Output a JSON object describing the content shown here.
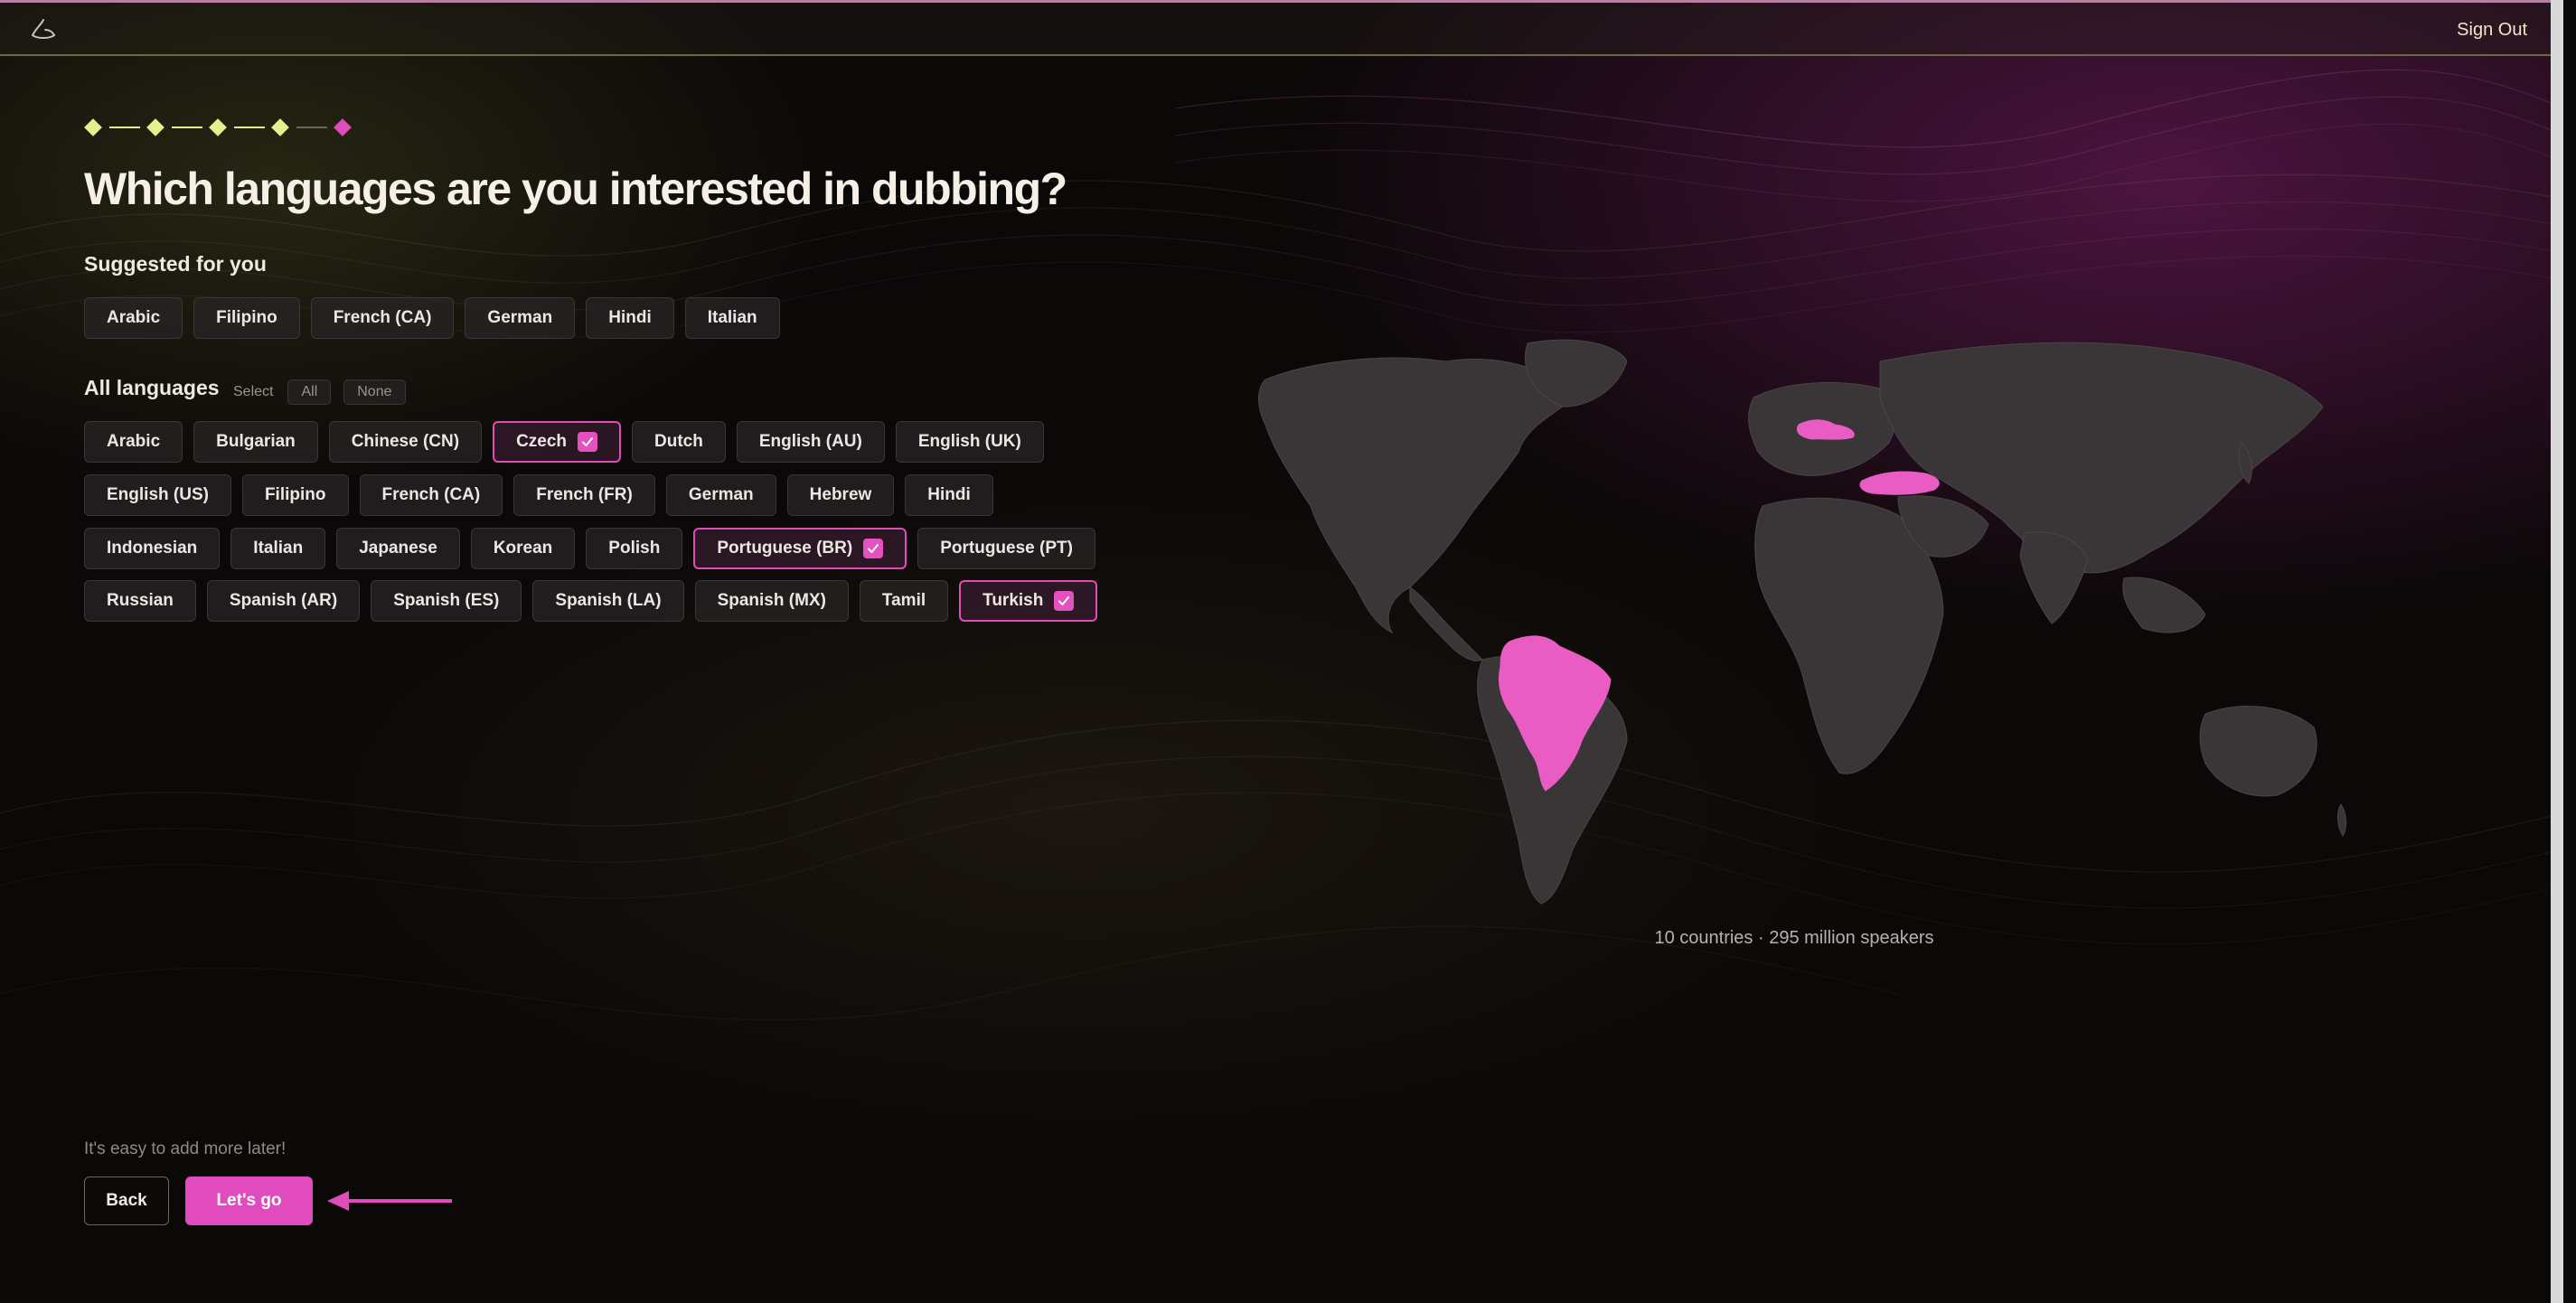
{
  "topbar": {
    "sign_out_label": "Sign Out"
  },
  "progress": {
    "total_steps": 5,
    "current_step": 5
  },
  "page": {
    "title": "Which languages are you interested in dubbing?"
  },
  "suggested": {
    "label": "Suggested for you",
    "items": [
      "Arabic",
      "Filipino",
      "French (CA)",
      "German",
      "Hindi",
      "Italian"
    ]
  },
  "all_languages": {
    "label": "All languages",
    "select_label": "Select",
    "all_label": "All",
    "none_label": "None",
    "rows": [
      [
        {
          "label": "Arabic",
          "selected": false
        },
        {
          "label": "Bulgarian",
          "selected": false
        },
        {
          "label": "Chinese (CN)",
          "selected": false
        },
        {
          "label": "Czech",
          "selected": true
        },
        {
          "label": "Dutch",
          "selected": false
        },
        {
          "label": "English (AU)",
          "selected": false
        },
        {
          "label": "English (UK)",
          "selected": false
        }
      ],
      [
        {
          "label": "English (US)",
          "selected": false
        },
        {
          "label": "Filipino",
          "selected": false
        },
        {
          "label": "French (CA)",
          "selected": false
        },
        {
          "label": "French (FR)",
          "selected": false
        },
        {
          "label": "German",
          "selected": false
        },
        {
          "label": "Hebrew",
          "selected": false
        },
        {
          "label": "Hindi",
          "selected": false
        }
      ],
      [
        {
          "label": "Indonesian",
          "selected": false
        },
        {
          "label": "Italian",
          "selected": false
        },
        {
          "label": "Japanese",
          "selected": false
        },
        {
          "label": "Korean",
          "selected": false
        },
        {
          "label": "Polish",
          "selected": false
        },
        {
          "label": "Portuguese (BR)",
          "selected": true
        },
        {
          "label": "Portuguese (PT)",
          "selected": false
        }
      ],
      [
        {
          "label": "Russian",
          "selected": false
        },
        {
          "label": "Spanish (AR)",
          "selected": false
        },
        {
          "label": "Spanish (ES)",
          "selected": false
        },
        {
          "label": "Spanish (LA)",
          "selected": false
        },
        {
          "label": "Spanish (MX)",
          "selected": false
        },
        {
          "label": "Tamil",
          "selected": false
        },
        {
          "label": "Turkish",
          "selected": true
        }
      ]
    ]
  },
  "map": {
    "highlighted_countries": [
      "Czech Republic",
      "Turkey",
      "Brazil"
    ],
    "stats_text": "10 countries · 295 million speakers"
  },
  "footer": {
    "hint": "It's easy to add more later!",
    "back_label": "Back",
    "go_label": "Let's go"
  },
  "colors": {
    "accent": "#e04bbd",
    "step_done": "#e6ef8f",
    "step_current": "#e04bbd",
    "map_land": "#3a3638",
    "map_highlight": "#e85cc4"
  }
}
